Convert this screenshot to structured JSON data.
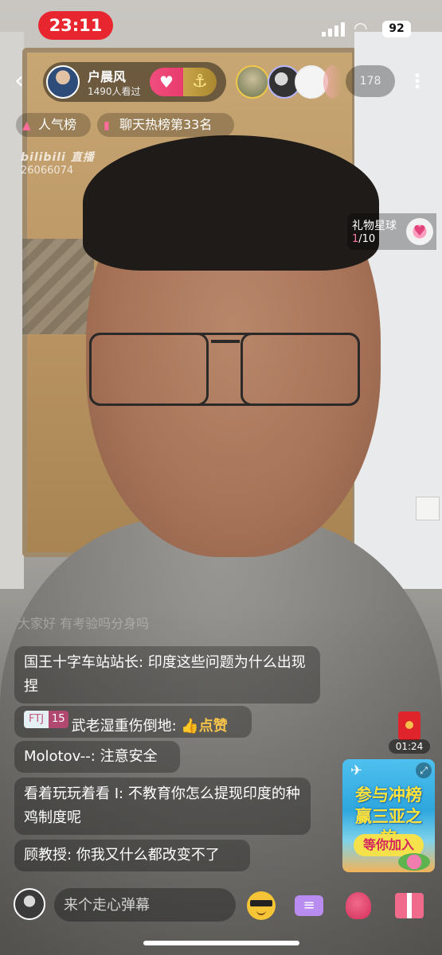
{
  "status_bar": {
    "time": "23:11",
    "battery": "92"
  },
  "anchor": {
    "name": "户晨风",
    "viewers": "1490人看过",
    "follow_icon": "heart-plus-icon",
    "guard_icon": "anchor-icon"
  },
  "online_count": "178",
  "rank_badges": [
    {
      "label": "人气榜",
      "icon": "popularity-icon"
    },
    {
      "label": "聊天热榜第33名",
      "icon": "hot-chart-icon"
    }
  ],
  "watermark": {
    "brand": "bilibili 直播",
    "room_id": "26066074"
  },
  "gift_planet": {
    "title": "礼物星球",
    "progress_current": "1",
    "progress_total": "/10"
  },
  "faded_message": "大家好 有考验吗分身吗",
  "chat": [
    {
      "user": "国王十字车站站长",
      "text": "印度这些问题为什么出现捏"
    },
    {
      "medal_name": "FTJ",
      "medal_level": "15",
      "user": "武老湿重伤倒地",
      "text": "点赞"
    },
    {
      "user": "Molotov--",
      "text": "注意安全"
    },
    {
      "user": "看着玩玩着看 I",
      "text": "不教育你怎么提现印度的种鸡制度呢"
    },
    {
      "user": "顾教授",
      "text": "你我又什么都改变不了"
    }
  ],
  "red_packet": {
    "timer": "01:24"
  },
  "promo": {
    "title": "参与冲榜赢三亚之旅",
    "button": "等你加入"
  },
  "bottom_bar": {
    "input_placeholder": "来个走心弹幕"
  }
}
